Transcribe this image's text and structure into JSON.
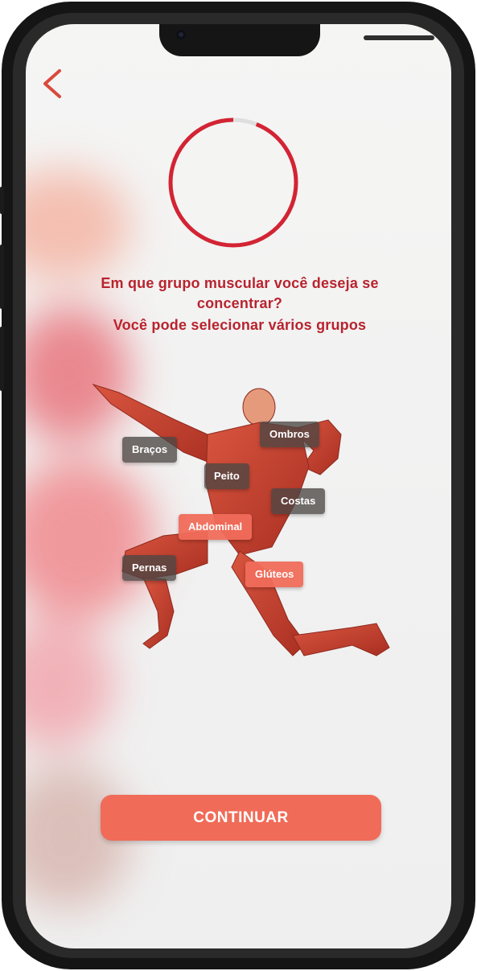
{
  "header": {
    "back_icon": "chevron-left-icon"
  },
  "progress": {
    "value": 0.06,
    "color": "#d32434"
  },
  "question": {
    "line1": "Em que grupo muscular você deseja se",
    "line2": "concentrar?",
    "line3": "Você pode selecionar vários grupos"
  },
  "muscle_groups": [
    {
      "label": "Braços",
      "selected": false
    },
    {
      "label": "Ombros",
      "selected": false
    },
    {
      "label": "Peito",
      "selected": false
    },
    {
      "label": "Costas",
      "selected": false
    },
    {
      "label": "Abdominal",
      "selected": true
    },
    {
      "label": "Pernas",
      "selected": false
    },
    {
      "label": "Glúteos",
      "selected": true
    }
  ],
  "footer": {
    "continue_label": "CONTINUAR"
  },
  "colors": {
    "accent": "#f06b58",
    "title": "#b8232e",
    "tag_selected": "#f06b5a",
    "tag_unselected": "#4b4644"
  }
}
